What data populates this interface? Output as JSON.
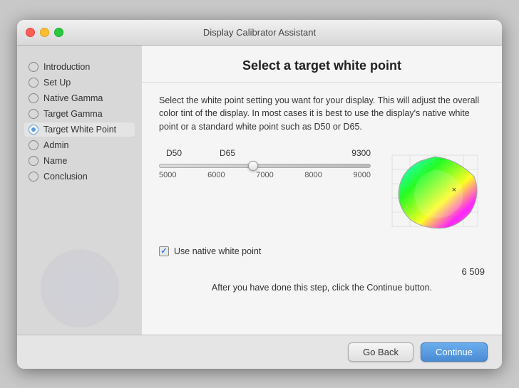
{
  "window": {
    "title": "Display Calibrator Assistant"
  },
  "sidebar": {
    "items": [
      {
        "id": "introduction",
        "label": "Introduction",
        "active": false
      },
      {
        "id": "setup",
        "label": "Set Up",
        "active": false
      },
      {
        "id": "native-gamma",
        "label": "Native Gamma",
        "active": false
      },
      {
        "id": "target-gamma",
        "label": "Target Gamma",
        "active": false
      },
      {
        "id": "target-white-point",
        "label": "Target White Point",
        "active": true
      },
      {
        "id": "admin",
        "label": "Admin",
        "active": false
      },
      {
        "id": "name",
        "label": "Name",
        "active": false
      },
      {
        "id": "conclusion",
        "label": "Conclusion",
        "active": false
      }
    ]
  },
  "main": {
    "title": "Select a target white point",
    "description": "Select the white point setting you want for your display.  This will adjust the overall color tint of the display.  In most cases it is best to use the display's native white point or a standard white point such as D50 or D65.",
    "slider": {
      "label_d50": "D50",
      "label_d65": "D65",
      "label_9300": "9300",
      "bottom_labels": [
        "5000",
        "6000",
        "7000",
        "8000",
        "9000"
      ]
    },
    "checkbox": {
      "label": "Use native white point",
      "checked": true
    },
    "value_display": "6 509",
    "after_text": "After you have done this step, click the Continue button.",
    "buttons": {
      "back": "Go Back",
      "continue": "Continue"
    }
  }
}
